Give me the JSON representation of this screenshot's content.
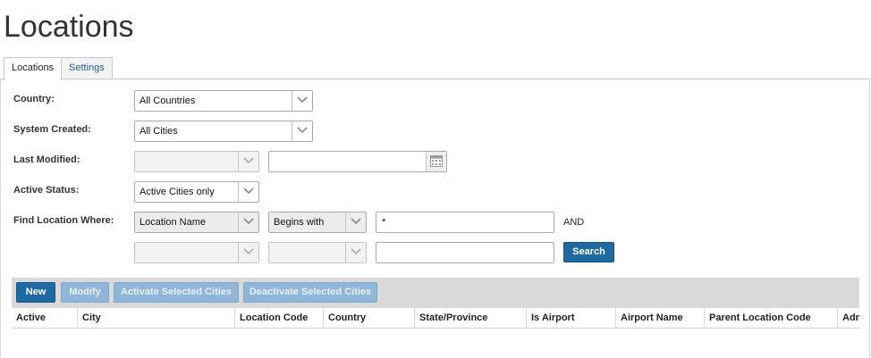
{
  "page": {
    "title": "Locations"
  },
  "tabs": [
    {
      "label": "Locations",
      "active": true
    },
    {
      "label": "Settings",
      "active": false
    }
  ],
  "filters": {
    "country": {
      "label": "Country:",
      "value": "All Countries"
    },
    "system_created": {
      "label": "System Created:",
      "value": "All Cities"
    },
    "last_modified": {
      "label": "Last Modified:",
      "select_value": "",
      "date_value": ""
    },
    "active_status": {
      "label": "Active Status:",
      "value": "Active Cities only"
    },
    "find_location": {
      "label": "Find Location Where:",
      "row1": {
        "field": "Location Name",
        "operator": "Begins with",
        "value": "*",
        "conjunction": "AND"
      },
      "row2": {
        "field": "",
        "operator": "",
        "value": ""
      }
    },
    "search_label": "Search"
  },
  "toolbar": {
    "new_label": "New",
    "modify_label": "Modify",
    "activate_label": "Activate Selected Cities",
    "deactivate_label": "Deactivate Selected Cities"
  },
  "grid": {
    "columns": [
      "Active",
      "City",
      "Location Code",
      "Country",
      "State/Province",
      "Is Airport",
      "Airport Name",
      "Parent Location Code",
      "Adm"
    ],
    "rows": []
  },
  "icons": {
    "dropdown": "chevron-down-icon",
    "calendar": "calendar-icon"
  },
  "colors": {
    "primary": "#1d6aa5",
    "disabled_button": "#8fb5d8",
    "tab_link": "#1a5d95"
  }
}
